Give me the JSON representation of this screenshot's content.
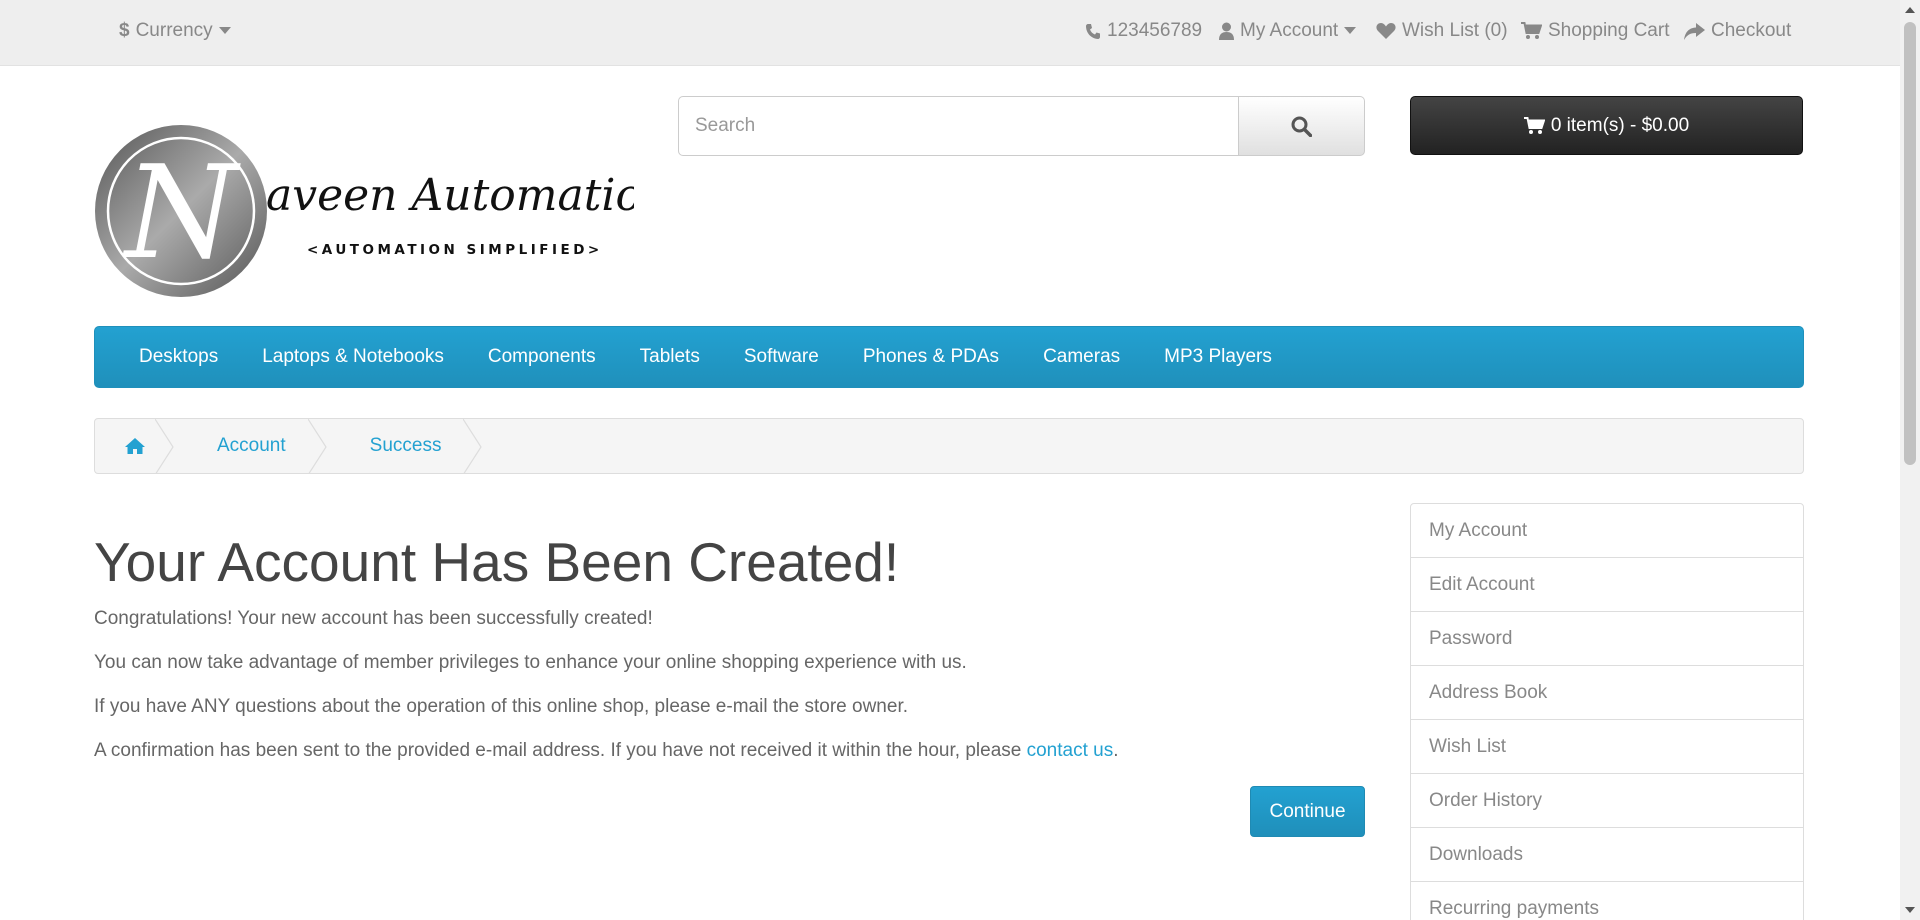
{
  "topbar": {
    "currency_label": "Currency",
    "phone": "123456789",
    "my_account_label": "My Account",
    "wishlist_label": "Wish List (0)",
    "shopping_cart_label": "Shopping Cart",
    "checkout_label": "Checkout"
  },
  "logo": {
    "title": "aveen Automation Labs",
    "letter": "N",
    "tagline": "<AUTOMATION SIMPLIFIED>"
  },
  "search": {
    "placeholder": "Search"
  },
  "cart": {
    "label": "0 item(s) - $0.00"
  },
  "menu": {
    "items": [
      "Desktops",
      "Laptops & Notebooks",
      "Components",
      "Tablets",
      "Software",
      "Phones & PDAs",
      "Cameras",
      "MP3 Players"
    ]
  },
  "breadcrumb": {
    "items": [
      "Account",
      "Success"
    ]
  },
  "content": {
    "heading": "Your Account Has Been Created!",
    "p1": "Congratulations! Your new account has been successfully created!",
    "p2": "You can now take advantage of member privileges to enhance your online shopping experience with us.",
    "p3": "If you have ANY questions about the operation of this online shop, please e-mail the store owner.",
    "p4_text": "A confirmation has been sent to the provided e-mail address. If you have not received it within the hour, please ",
    "p4_link": "contact us",
    "p4_end": ".",
    "continue_label": "Continue"
  },
  "sidebar": {
    "items": [
      "My Account",
      "Edit Account",
      "Password",
      "Address Book",
      "Wish List",
      "Order History",
      "Downloads",
      "Recurring payments"
    ]
  },
  "colors": {
    "accent": "#23a1d1",
    "topbar_bg": "#eeeeee",
    "cart_bg": "#222222"
  }
}
